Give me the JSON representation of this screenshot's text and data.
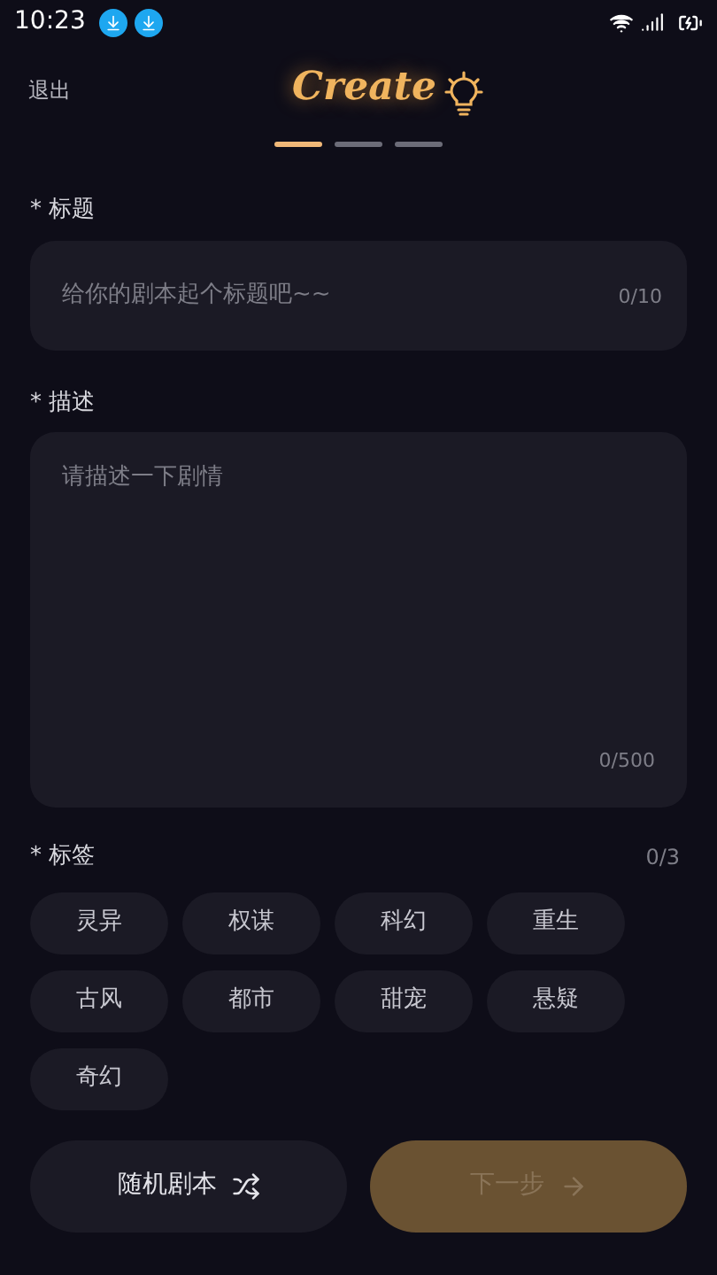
{
  "status_bar": {
    "time": "10:23"
  },
  "header": {
    "exit": "退出",
    "logo": "Create"
  },
  "steps": [
    {
      "selected": true
    },
    {
      "selected": false
    },
    {
      "selected": false
    }
  ],
  "title_field": {
    "label": "* 标题",
    "placeholder": "给你的剧本起个标题吧~~",
    "counter": "0/10"
  },
  "description_field": {
    "label": "* 描述",
    "placeholder": "请描述一下剧情",
    "counter": "0/500"
  },
  "tags": {
    "label": "* 标签",
    "counter": "0/3",
    "items": [
      {
        "label": "灵异",
        "selected": false
      },
      {
        "label": "权谋",
        "selected": false
      },
      {
        "label": "科幻",
        "selected": false
      },
      {
        "label": "重生",
        "selected": false
      },
      {
        "label": "古风",
        "selected": false
      },
      {
        "label": "都市",
        "selected": false
      },
      {
        "label": "甜宠",
        "selected": false
      },
      {
        "label": "悬疑",
        "selected": false
      },
      {
        "label": "奇幻",
        "selected": false
      }
    ]
  },
  "random_button": {
    "label": "随机剧本"
  },
  "next_button": {
    "label": "下一步",
    "disabled": true
  }
}
